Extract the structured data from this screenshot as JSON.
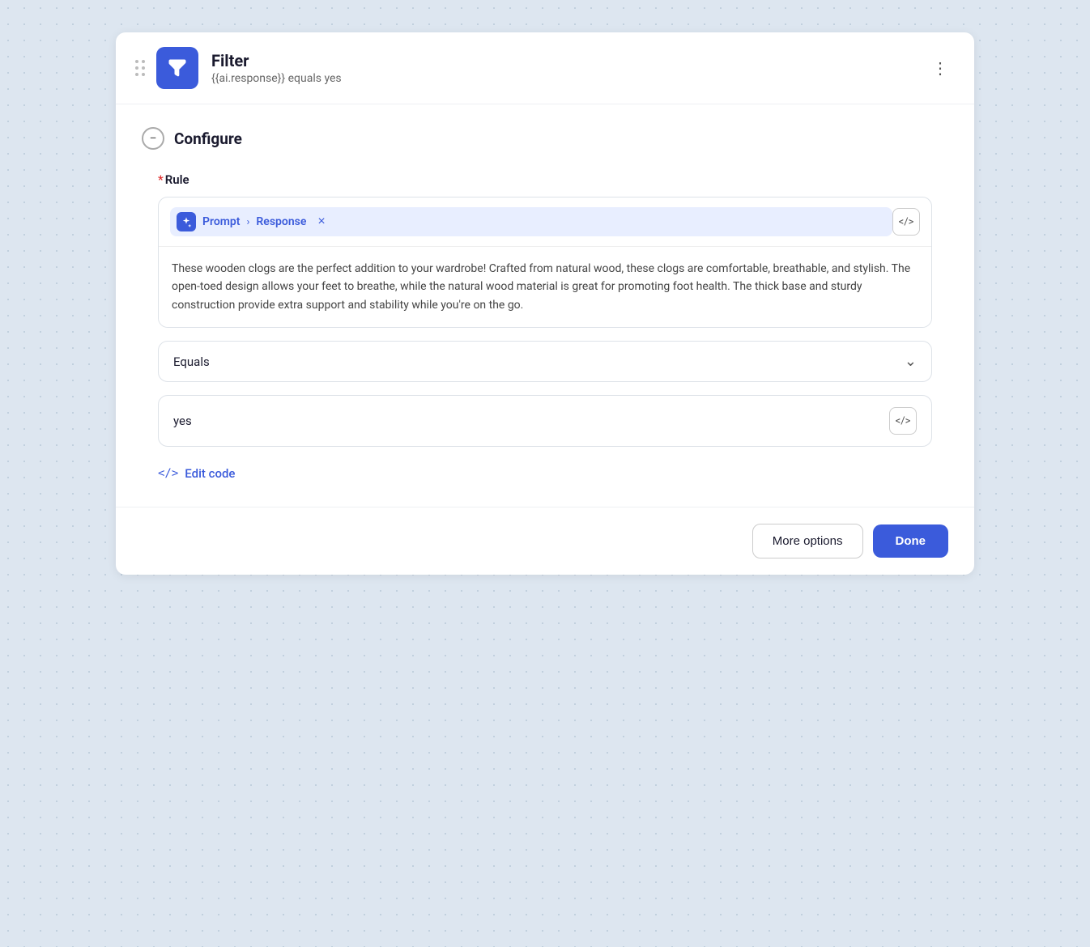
{
  "header": {
    "title": "Filter",
    "subtitle": "{{ai.response}} equals yes",
    "more_options_icon": "⋮"
  },
  "configure": {
    "section_title": "Configure",
    "rule_label": "*Rule",
    "rule_required_marker": "*",
    "rule_label_text": "Rule",
    "prompt_label": "Prompt",
    "response_label": "Response",
    "rule_content": "These wooden clogs are the perfect addition to your wardrobe! Crafted from natural wood, these clogs are comfortable, breathable, and stylish. The open-toed design allows your feet to breathe, while the natural wood material is great for promoting foot health. The thick base and sturdy construction provide extra support and stability while you're on the go.",
    "equals_label": "Equals",
    "value_label": "yes",
    "edit_code_label": "Edit code"
  },
  "footer": {
    "more_options_label": "More options",
    "done_label": "Done"
  },
  "icons": {
    "filter": "funnel",
    "stars": "✦",
    "chevron_right": "›",
    "chevron_down": "⌄",
    "close": "×",
    "code": "</>",
    "edit_code_prefix": "</>"
  }
}
